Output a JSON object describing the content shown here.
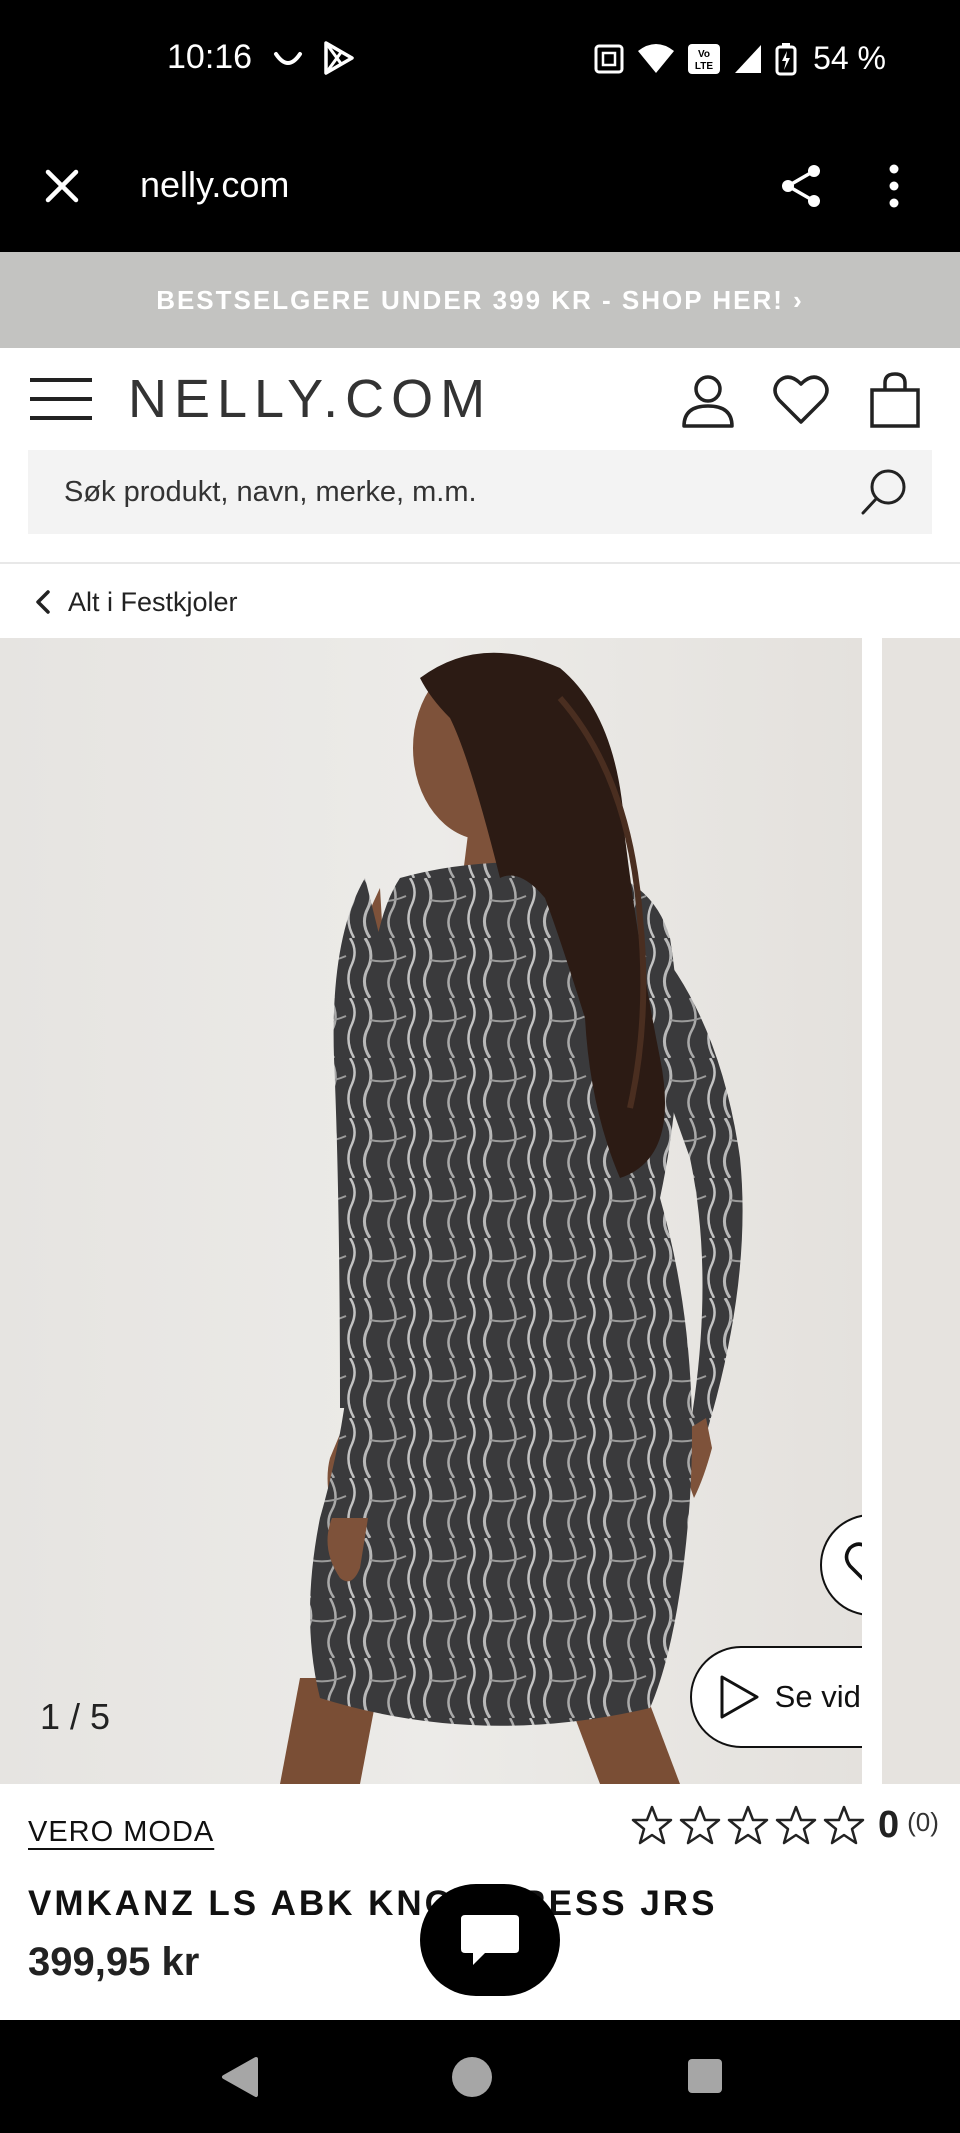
{
  "status_bar": {
    "time": "10:16",
    "battery": "54 %"
  },
  "browser": {
    "url": "nelly.com"
  },
  "promo": {
    "text": "BESTSELGERE UNDER 399 KR - SHOP HER! ›"
  },
  "header": {
    "logo": "NELLY.COM"
  },
  "search": {
    "placeholder": "Søk produkt, navn, merke, m.m."
  },
  "breadcrumb": {
    "label": "Alt i Festkjoler"
  },
  "gallery": {
    "counter": "1 / 5",
    "video_label": "Se video"
  },
  "product": {
    "brand": "VERO MODA",
    "title": "VMKANZ LS ABK KNOT DRESS JRS",
    "price": "399,95 kr",
    "rating_value": "0",
    "rating_count": "(0)",
    "stars_filled": 0,
    "stars_total": 5
  },
  "colors": {
    "promo_bg": "#c3c3c1",
    "search_bg": "#f3f3f3",
    "photo_bg": "#e9e7e4"
  }
}
